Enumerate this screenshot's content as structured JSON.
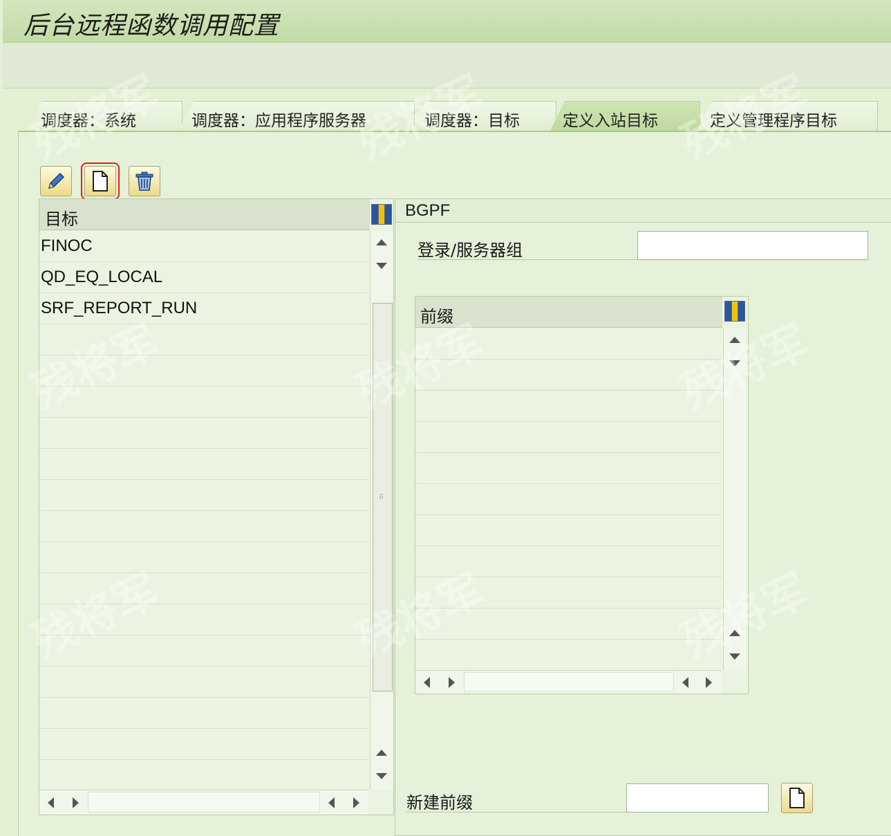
{
  "window": {
    "title": "后台远程函数调用配置"
  },
  "tabs": [
    {
      "label": "调度器：系统",
      "active": false
    },
    {
      "label": "调度器：应用程序服务器",
      "active": false
    },
    {
      "label": "调度器：目标",
      "active": false
    },
    {
      "label": "定义入站目标",
      "active": true
    },
    {
      "label": "定义管理程序目标",
      "active": false
    }
  ],
  "toolbar": {
    "buttons": [
      {
        "icon": "pencil-icon",
        "action": "edit"
      },
      {
        "icon": "new-document-icon",
        "action": "create",
        "highlighted": true
      },
      {
        "icon": "trash-icon",
        "action": "delete"
      }
    ]
  },
  "target_table": {
    "header": "目标",
    "rows": [
      "FINOC",
      "QD_EQ_LOCAL",
      "SRF_REPORT_RUN",
      "",
      "",
      "",
      "",
      "",
      "",
      "",
      "",
      "",
      "",
      "",
      "",
      "",
      "",
      ""
    ]
  },
  "detail": {
    "title": "BGPF",
    "logon_group_label": "登录/服务器组",
    "logon_group_value": "",
    "prefix_table": {
      "header": "前缀",
      "rows": [
        "",
        "",
        "",
        "",
        "",
        "",
        "",
        "",
        "",
        "",
        ""
      ]
    },
    "new_prefix_label": "新建前缀",
    "new_prefix_value": ""
  },
  "watermark": "残将军",
  "colors": {
    "highlight": "#e02020",
    "tab_active": "#c6dea8",
    "panel": "#e5f1d8"
  }
}
